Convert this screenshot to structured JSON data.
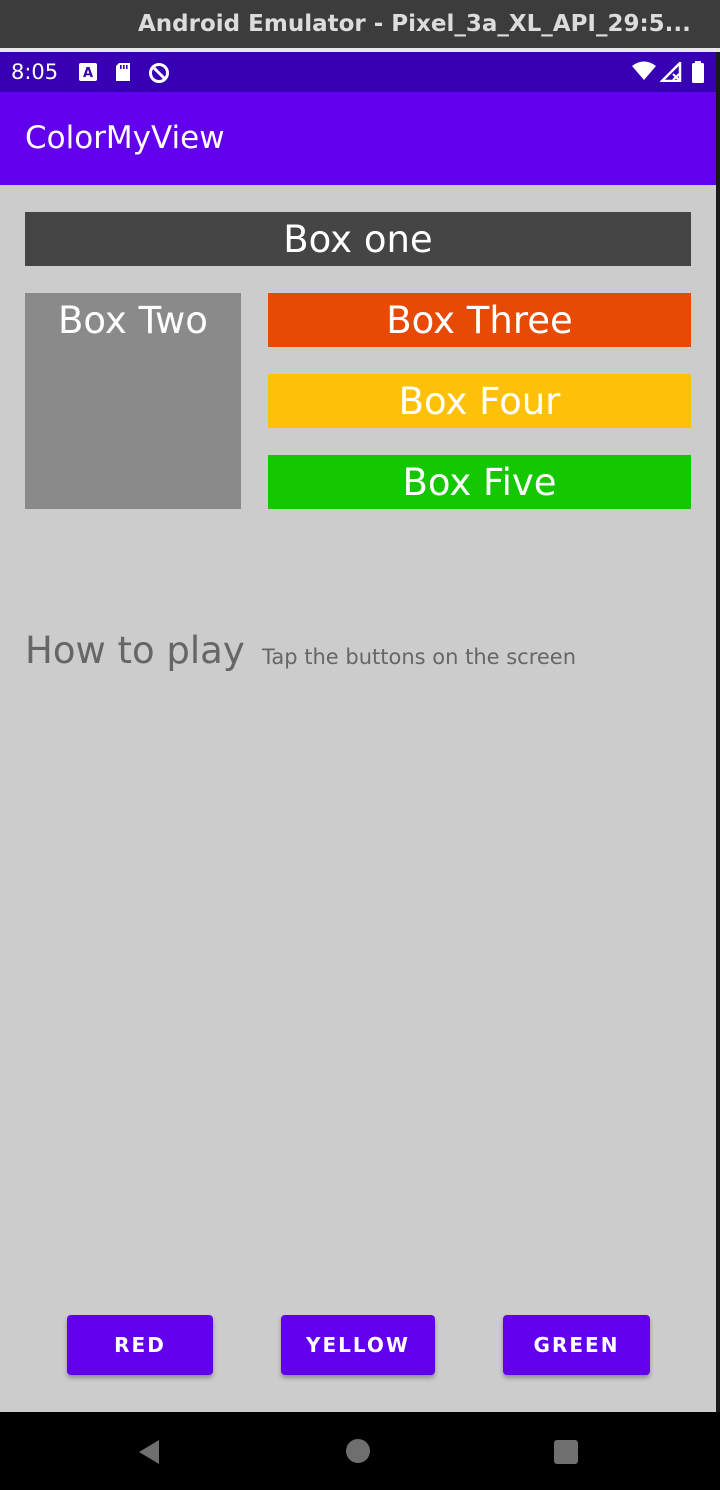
{
  "window": {
    "title": "Android Emulator - Pixel_3a_XL_API_29:5..."
  },
  "status_bar": {
    "time": "8:05",
    "icons": [
      "font-notification-icon",
      "sd-card-icon",
      "assistant-icon",
      "wifi-icon",
      "signal-icon",
      "battery-icon"
    ]
  },
  "app_bar": {
    "title": "ColorMyView",
    "color": "#6200ee"
  },
  "boxes": {
    "one": {
      "label": "Box one",
      "color": "#454545"
    },
    "two": {
      "label": "Box Two",
      "color": "#8a8a8a"
    },
    "three": {
      "label": "Box Three",
      "color": "#e64a04"
    },
    "four": {
      "label": "Box Four",
      "color": "#fec008"
    },
    "five": {
      "label": "Box Five",
      "color": "#13c800"
    }
  },
  "instructions": {
    "heading": "How to play",
    "text": "Tap the buttons on the screen"
  },
  "buttons": {
    "red": "RED",
    "yellow": "YELLOW",
    "green": "GREEN"
  },
  "nav_bar": {
    "icons": [
      "back-icon",
      "home-icon",
      "recents-icon"
    ]
  }
}
